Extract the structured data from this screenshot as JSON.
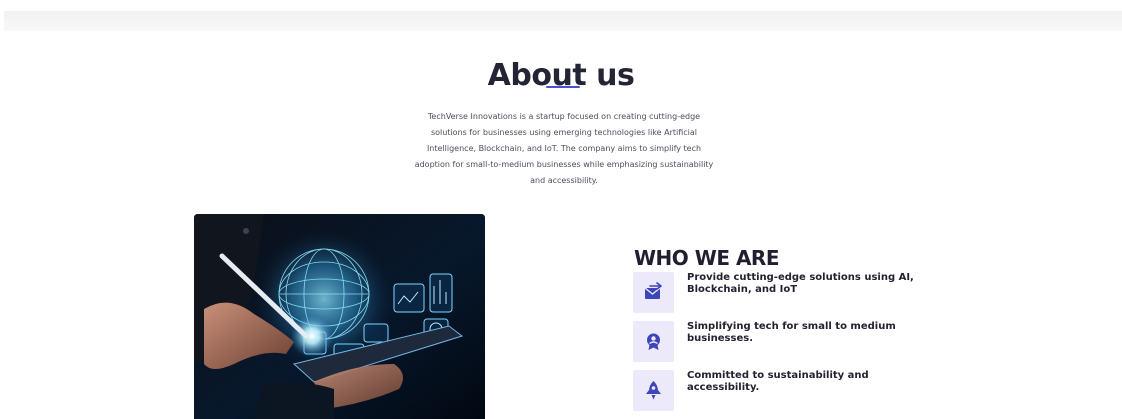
{
  "about": {
    "title": "About us",
    "description": "TechVerse Innovations is a startup focused on creating cutting-edge solutions for businesses using emerging technologies like Artificial Intelligence, Blockchain, and IoT. The company aims to simplify tech adoption for small-to-medium businesses while emphasizing sustainability and accessibility.",
    "accent_color": "#4b4fd1"
  },
  "who_we_are": {
    "title": "WHO WE ARE",
    "features": [
      {
        "icon": "inbox-arrow-icon",
        "text": "Provide cutting-edge solutions using AI, Blockchain, and IoT"
      },
      {
        "icon": "badge-person-icon",
        "text": "Simplifying tech for small to medium businesses."
      },
      {
        "icon": "rocket-icon",
        "text": "Committed to sustainability and accessibility."
      }
    ],
    "icon_color": "#3e45b8",
    "icon_bg_color": "#eceafa"
  },
  "hero_image": {
    "subject": "hand-with-stylus-over-tablet-with-globe-hologram"
  }
}
